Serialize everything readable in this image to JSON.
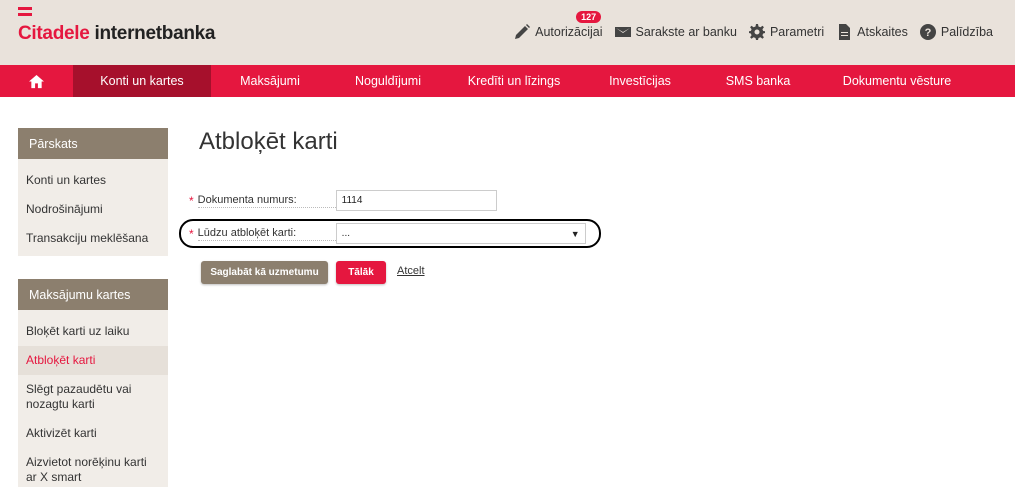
{
  "header": {
    "brand_part1": "Citadele",
    "brand_part2": " internetbanka",
    "links": {
      "authorizations": {
        "label": "Autorizācijai",
        "badge": "127"
      },
      "messages": {
        "label": "Sarakste ar banku"
      },
      "settings": {
        "label": "Parametri"
      },
      "reports": {
        "label": "Atskaites"
      },
      "help": {
        "label": "Palīdzība"
      }
    }
  },
  "nav": {
    "items": [
      {
        "label": "Konti un kartes"
      },
      {
        "label": "Maksājumi"
      },
      {
        "label": "Noguldījumi"
      },
      {
        "label": "Kredīti un līzings"
      },
      {
        "label": "Investīcijas"
      },
      {
        "label": "SMS banka"
      },
      {
        "label": "Dokumentu vēsture"
      }
    ]
  },
  "sidebar": {
    "overview": {
      "title": "Pārskats",
      "items": [
        {
          "label": "Konti un kartes"
        },
        {
          "label": "Nodrošinājumi"
        },
        {
          "label": "Transakciju meklēšana"
        }
      ]
    },
    "payment_cards": {
      "title": "Maksājumu kartes",
      "items": [
        {
          "label": "Bloķēt karti uz laiku"
        },
        {
          "label": "Atbloķēt karti"
        },
        {
          "label": "Slēgt pazaudētu vai nozagtu karti"
        },
        {
          "label": "Aktivizēt karti"
        },
        {
          "label": "Aizvietot norēķinu karti ar X smart"
        }
      ]
    }
  },
  "main": {
    "title": "Atbloķēt karti",
    "form": {
      "document_number": {
        "required": "*",
        "label": "Dokumenta numurs:",
        "value": "1114"
      },
      "card": {
        "required": "*",
        "label": "Lūdzu atbloķēt karti:",
        "value": "...",
        "caret": "▼"
      }
    },
    "buttons": {
      "save_template": "Saglabāt kā uzmetumu",
      "next": "Tālāk",
      "cancel": "Atcelt"
    }
  },
  "colors": {
    "accent": "#e5173f",
    "accent_dark": "#a6102c",
    "header_bg": "#e9e2db",
    "sidebar_head": "#8c7f6e",
    "sidebar_bg": "#f1ede8"
  }
}
